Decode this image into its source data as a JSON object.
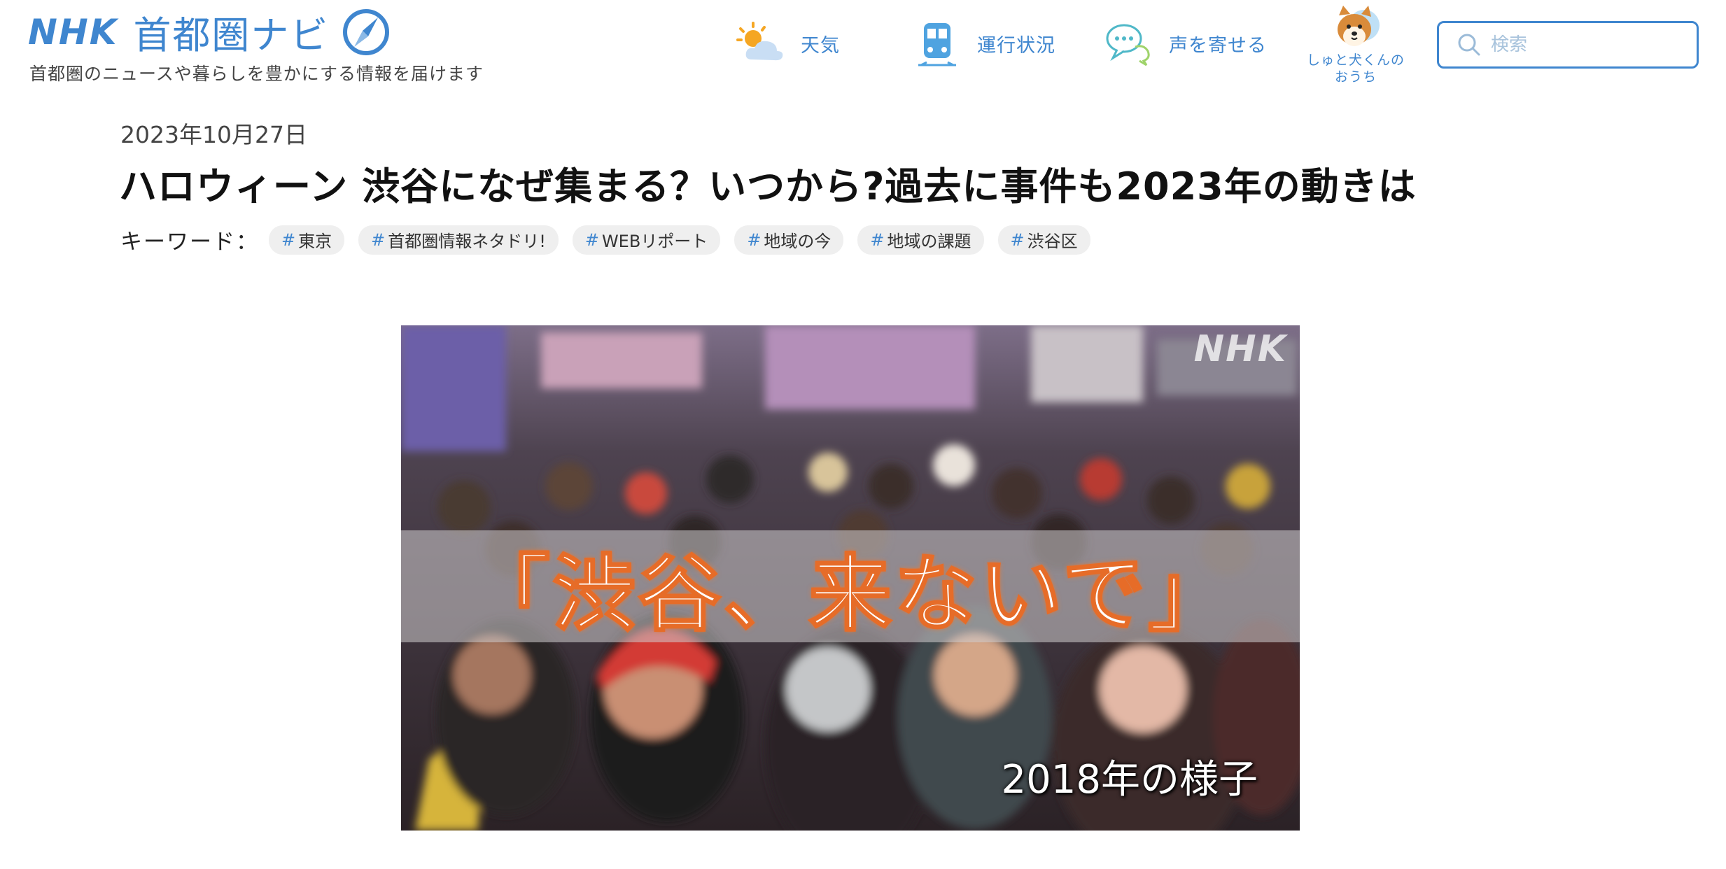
{
  "header": {
    "logo_brand": "NHK",
    "logo_title": "首都圏ナビ",
    "tagline": "首都圏のニュースや暮らしを豊かにする情報を届けます",
    "nav": [
      {
        "label": "天気",
        "icon": "weather-icon"
      },
      {
        "label": "運行状況",
        "icon": "train-icon"
      },
      {
        "label": "声を寄せる",
        "icon": "chat-bubble-icon"
      }
    ],
    "mascot": {
      "label_line1": "しゅと犬くんの",
      "label_line2": "おうち",
      "icon": "shiba-dog-icon"
    },
    "search": {
      "placeholder": "検索"
    }
  },
  "article": {
    "date": "2023年10月27日",
    "headline": "ハロウィーン 渋谷になぜ集まる？いつから?過去に事件も2023年の動きは",
    "keywords_label": "キーワード：",
    "keywords": [
      "東京",
      "首都圏情報ネタドリ!",
      "WEBリポート",
      "地域の今",
      "地域の課題",
      "渋谷区"
    ],
    "hero": {
      "quote": "「渋谷、来ないで」",
      "caption": "2018年の様子",
      "watermark": "NHK"
    }
  },
  "colors": {
    "brand_blue": "#3f86cf",
    "quote_outline": "#e66c28",
    "tag_background": "#efefef"
  }
}
